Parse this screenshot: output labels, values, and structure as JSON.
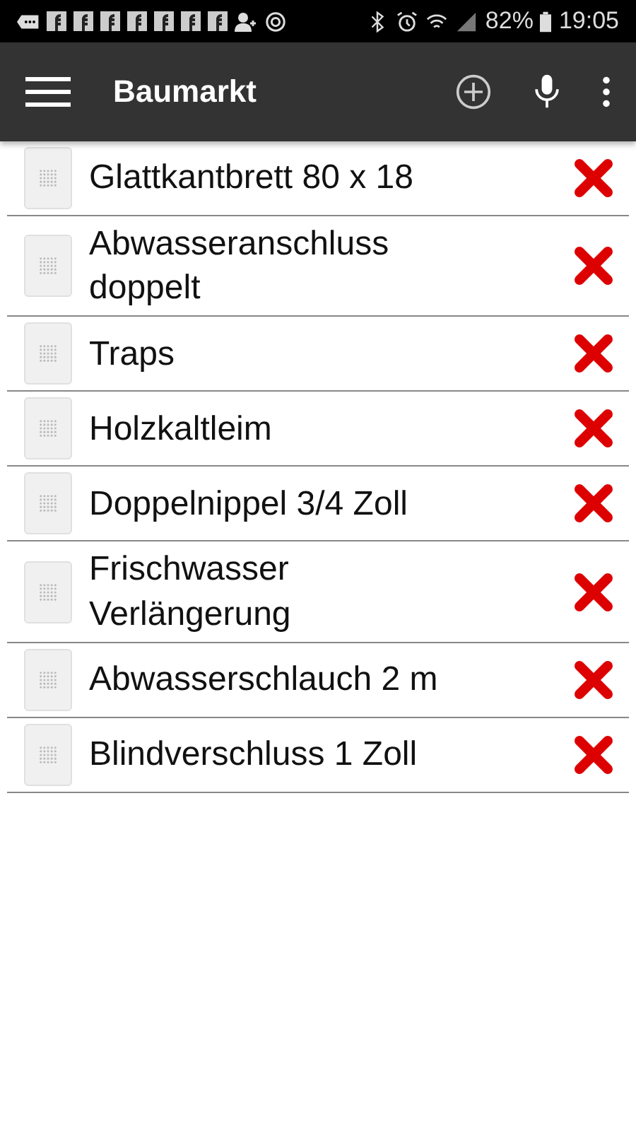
{
  "status_bar": {
    "battery": "82%",
    "time": "19:05"
  },
  "toolbar": {
    "title": "Baumarkt"
  },
  "items": [
    {
      "text": "Glattkantbrett 80 x 18"
    },
    {
      "text": "Abwasseranschluss doppelt"
    },
    {
      "text": "Traps"
    },
    {
      "text": "Holzkaltleim"
    },
    {
      "text": "Doppelnippel 3/4 Zoll"
    },
    {
      "text": "Frischwasser Verlängerung"
    },
    {
      "text": "Abwasserschlauch 2 m"
    },
    {
      "text": "Blindverschluss 1 Zoll"
    }
  ]
}
